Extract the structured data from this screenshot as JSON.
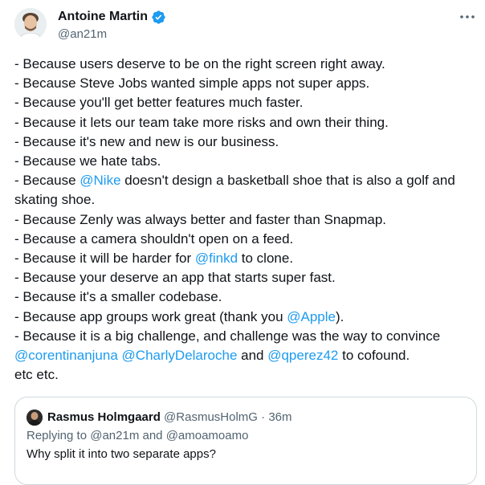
{
  "author": {
    "name": "Antoine Martin",
    "handle": "@an21m",
    "verified": true,
    "badge_color": "#1d9bf0"
  },
  "more_icon": "more-horizontal-icon",
  "body": {
    "l1": "- Because users deserve to be on the right screen right away.",
    "l2": "- Because Steve Jobs wanted simple apps not super apps.",
    "l3": "- Because you'll get better features much faster.",
    "l4": "- Because it lets our team take more risks and own their thing.",
    "l5": "- Because it's new and new is our business.",
    "l6": "- Because we hate tabs.",
    "l7a": "- Because ",
    "l7_mention": "@Nike",
    "l7b": " doesn't design a basketball shoe that is also a golf and",
    "l8": "skating shoe.",
    "l9": "- Because Zenly was always better and faster than Snapmap.",
    "l10": "- Because a camera shouldn't open on a feed.",
    "l11a": "- Because it will be harder for ",
    "l11_mention": "@finkd",
    "l11b": " to clone.",
    "l12": "- Because your deserve an app that starts super fast.",
    "l13": "- Because it's a smaller codebase.",
    "l14a": "- Because app groups work great (thank you ",
    "l14_mention": "@Apple",
    "l14b": ").",
    "l15": "- Because it is a big challenge, and challenge was the way to convince",
    "l16_mention1": "@corentinanjuna",
    "l16_space": " ",
    "l16_mention2": "@CharlyDelaroche",
    "l16_and": " and ",
    "l16_mention3": "@qperez42",
    "l16b": " to cofound.",
    "l17": "etc etc."
  },
  "quote": {
    "name": "Rasmus Holmgaard",
    "handle": "@RasmusHolmG",
    "separator": "·",
    "time": "36m",
    "replying_prefix": "Replying to ",
    "replying_to_1": "@an21m",
    "replying_and": " and ",
    "replying_to_2": "@amoamoamo",
    "text": "Why split it into two separate apps?"
  },
  "colors": {
    "link": "#1d9bf0",
    "secondary": "#536471",
    "border": "#cfd9de"
  }
}
